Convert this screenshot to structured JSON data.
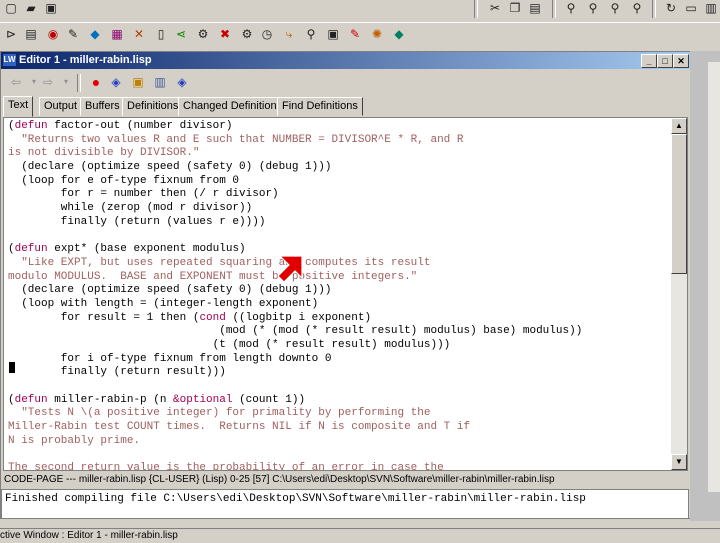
{
  "editor": {
    "title": "Editor 1 - miller-rabin.lisp",
    "tabs": [
      "Text",
      "Output",
      "Buffers",
      "Definitions",
      "Changed Definitions",
      "Find Definitions"
    ],
    "active_tab": "Text",
    "code_lines": [
      [
        [
          "(",
          "p"
        ],
        [
          "defun",
          "kw"
        ],
        [
          " factor-out (number divisor)",
          "p"
        ]
      ],
      [
        [
          "  \"Returns two values R and E such that NUMBER = DIVISOR^E * R, and R",
          "st"
        ]
      ],
      [
        [
          "is not divisible by DIVISOR.\"",
          "st"
        ]
      ],
      [
        [
          "  (declare (optimize speed (safety 0) (debug 1)))",
          "p"
        ]
      ],
      [
        [
          "  (loop for e of-type fixnum from 0",
          "p"
        ]
      ],
      [
        [
          "        for r = number then (/ r divisor)",
          "p"
        ]
      ],
      [
        [
          "        while (zerop (mod r divisor))",
          "p"
        ]
      ],
      [
        [
          "        finally (return (values r e))))",
          "p"
        ]
      ],
      [
        [
          "",
          "p"
        ]
      ],
      [
        [
          "(",
          "p"
        ],
        [
          "defun",
          "kw"
        ],
        [
          " expt* (base exponent modulus)",
          "p"
        ]
      ],
      [
        [
          "  \"Like EXPT, but uses repeated squaring and computes its result",
          "st"
        ]
      ],
      [
        [
          "modulo MODULUS.  BASE and EXPONENT must be positive integers.\"",
          "st"
        ]
      ],
      [
        [
          "  (declare (optimize speed (safety 0) (debug 1)))",
          "p"
        ]
      ],
      [
        [
          "  (loop with length = (integer-length exponent)",
          "p"
        ]
      ],
      [
        [
          "        for result = 1 then (",
          "p"
        ],
        [
          "cond",
          "kw"
        ],
        [
          " ((logbitp i exponent)",
          "p"
        ]
      ],
      [
        [
          "                                (mod (* (mod (* result result) modulus) base) modulus))",
          "p"
        ]
      ],
      [
        [
          "                               (t (mod (* result result) modulus)))",
          "p"
        ]
      ],
      [
        [
          "        for i of-type fixnum from length downto 0",
          "p"
        ]
      ],
      [
        [
          "        finally (return result)))",
          "p"
        ]
      ],
      [
        [
          "",
          "p"
        ]
      ],
      [
        [
          "(",
          "p"
        ],
        [
          "defun",
          "kw"
        ],
        [
          " miller-rabin-p (n ",
          "p"
        ],
        [
          "&optional",
          "kw"
        ],
        [
          " (count 1))",
          "p"
        ]
      ],
      [
        [
          "  \"Tests N \\(a positive integer) for primality by performing the",
          "st"
        ]
      ],
      [
        [
          "Miller-Rabin test COUNT times.  Returns NIL if N is composite and T if",
          "st"
        ]
      ],
      [
        [
          "N is probably prime.",
          "st"
        ]
      ],
      [
        [
          "",
          "p"
        ]
      ],
      [
        [
          "The second return value is the probability of an error in case the",
          "st"
        ]
      ]
    ],
    "status_line": "CODE-PAGE --- miller-rabin.lisp    {CL-USER} (Lisp) 0-25 [57] C:\\Users\\edi\\Desktop\\SVN\\Software\\miller-rabin\\miller-rabin.lisp",
    "output_text": "Finished compiling file C:\\Users\\edi\\Desktop\\SVN\\Software\\miller-rabin\\miller-rabin.lisp"
  },
  "statusbar": {
    "text": "ctive Window : Editor 1 - miller-rabin.lisp"
  },
  "colors": {
    "keyword": "#a00050",
    "string": "#a06060",
    "title_start": "#0a246a",
    "title_end": "#a6caf0"
  }
}
